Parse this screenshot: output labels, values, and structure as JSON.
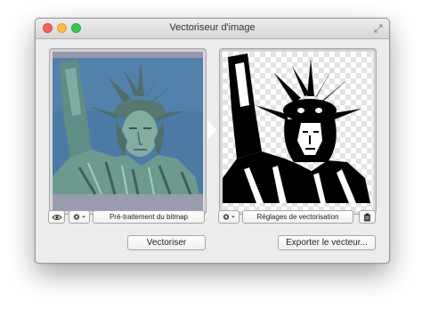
{
  "window": {
    "title": "Vectoriseur d'image"
  },
  "left_panel": {
    "image_name": "statue-of-liberty-photo",
    "preprocess_button": "Pré-traitement du bitmap"
  },
  "right_panel": {
    "image_name": "statue-of-liberty-vector",
    "settings_button": "Réglages de vectorisation"
  },
  "actions": {
    "vectorize_button": "Vectoriser",
    "export_button": "Exporter le vecteur..."
  },
  "icons": {
    "eye": "eye-icon",
    "gear": "gear-icon",
    "clipboard": "clipboard-icon",
    "fullscreen": "fullscreen-icon",
    "arrow": "arrow-right-icon"
  },
  "colors": {
    "window_bg": "#ececec",
    "close": "#fc605c",
    "minimize": "#fdbc40",
    "zoom": "#34c84a",
    "sky": "#4b7aa6",
    "statue": "#6d9a8f"
  }
}
